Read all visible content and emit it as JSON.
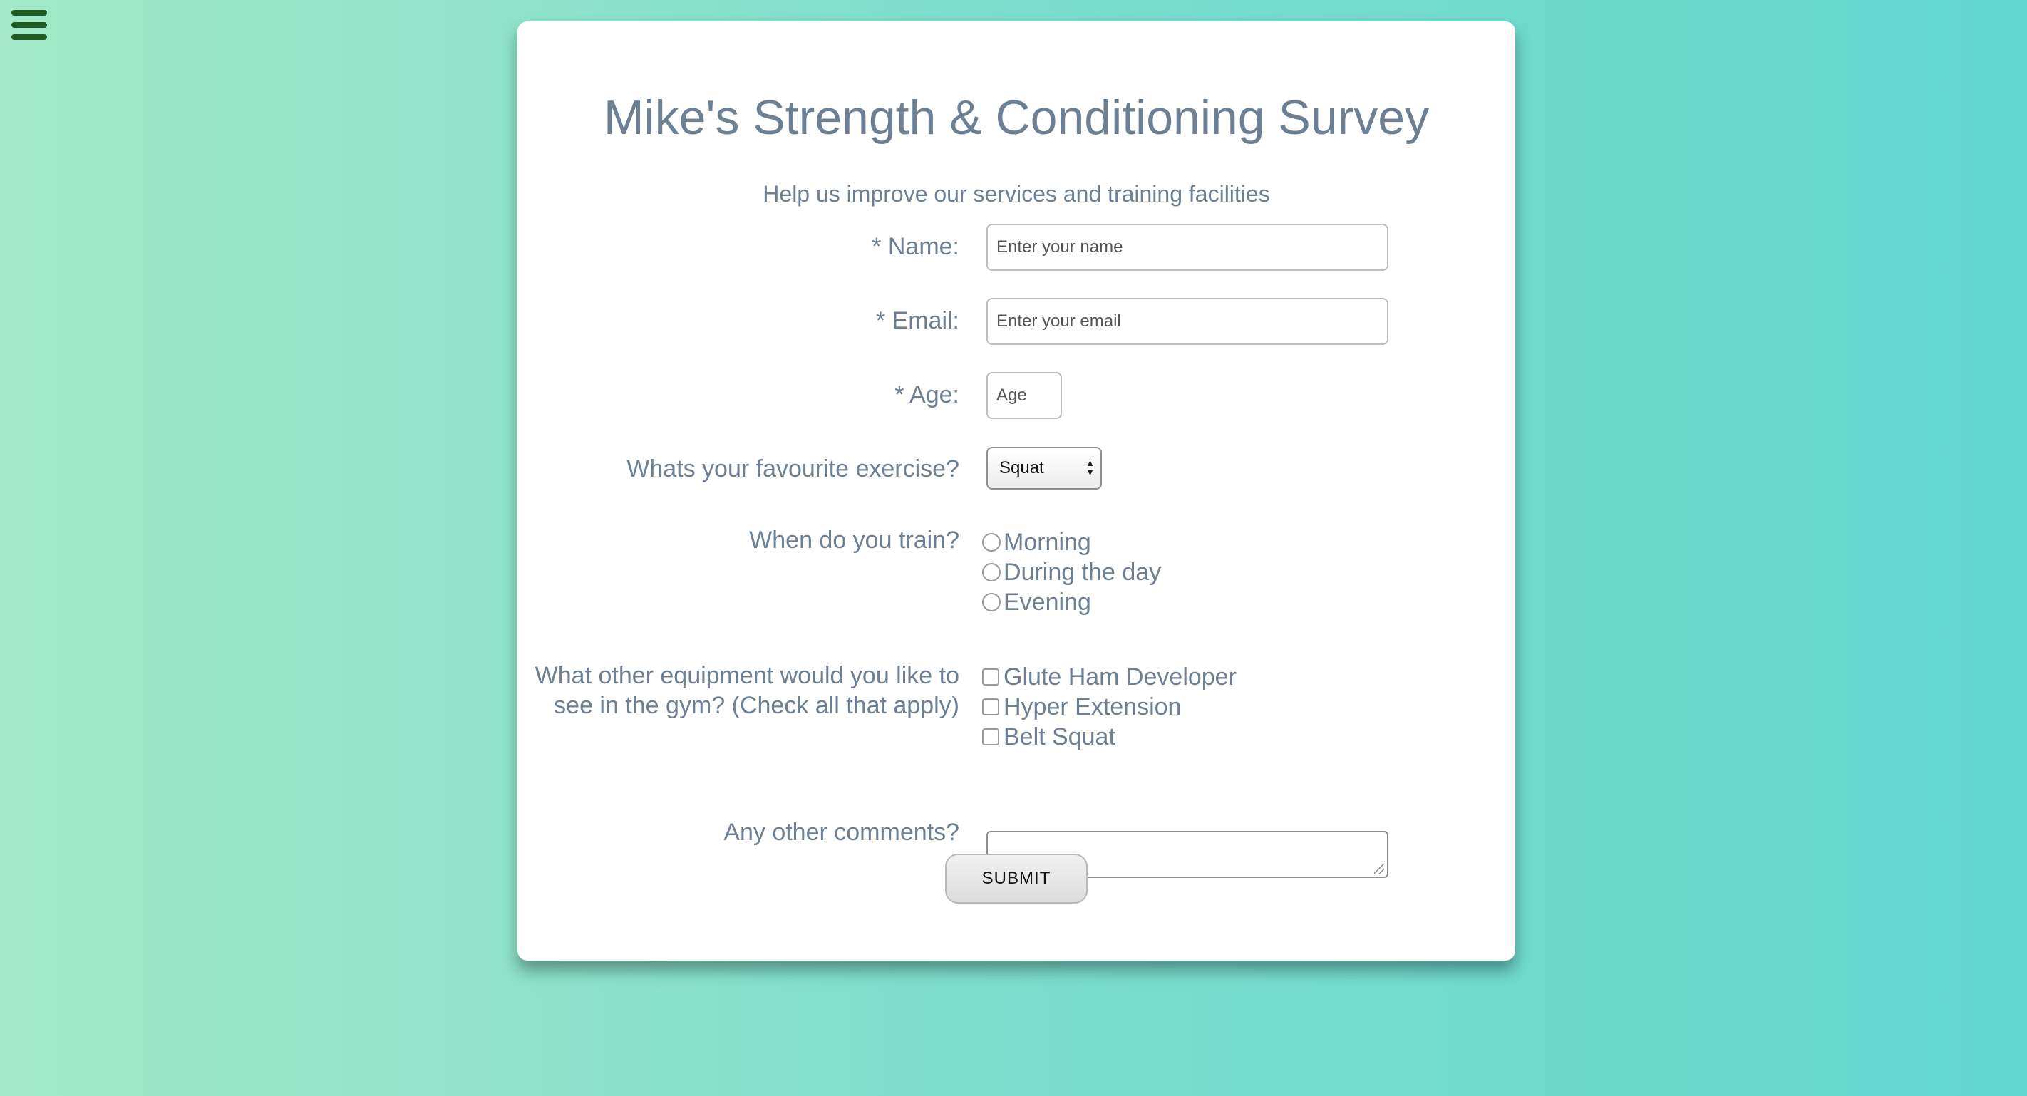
{
  "menu": {
    "icon": "hamburger-menu-icon"
  },
  "header": {
    "title": "Mike's Strength & Conditioning Survey",
    "subtitle": "Help us improve our services and training facilities"
  },
  "form": {
    "name": {
      "label": "* Name:",
      "placeholder": "Enter your name",
      "value": ""
    },
    "email": {
      "label": "* Email:",
      "placeholder": "Enter your email",
      "value": ""
    },
    "age": {
      "label": "* Age:",
      "placeholder": "Age",
      "value": ""
    },
    "exercise": {
      "label": "Whats your favourite exercise?",
      "selected": "Squat"
    },
    "train": {
      "label": "When do you train?",
      "options": [
        "Morning",
        "During the day",
        "Evening"
      ]
    },
    "equipment": {
      "label_line1": "What other equipment would you like to",
      "label_line2": "see in the gym? (Check all that apply)",
      "options": [
        "Glute Ham Developer",
        "Hyper Extension",
        "Belt Squat"
      ]
    },
    "comments": {
      "label": "Any other comments?",
      "value": ""
    },
    "submit_label": "SUBMIT"
  },
  "colors": {
    "text": "#6d7f93",
    "menu_icon": "#1f5a20",
    "bg_left": "#a3e8c8",
    "bg_right": "#62d6cf"
  }
}
